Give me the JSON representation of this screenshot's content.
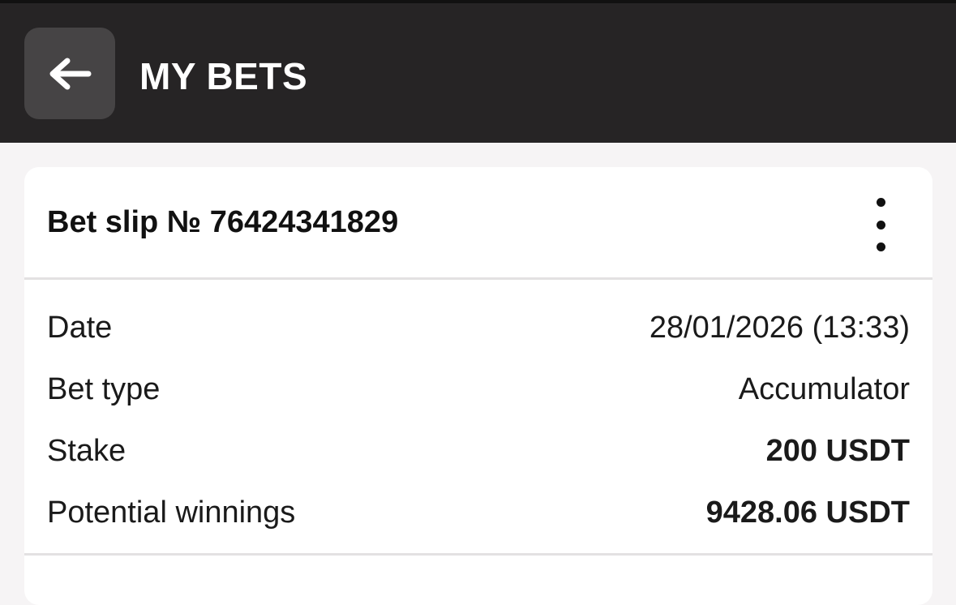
{
  "header": {
    "title": "MY BETS",
    "back_icon": "arrow-left-icon"
  },
  "bet_slip": {
    "title": "Bet slip № 76424341829",
    "menu_icon": "more-vertical-icon",
    "rows": [
      {
        "label": "Date",
        "value": "28/01/2026 (13:33)"
      },
      {
        "label": "Bet type",
        "value": "Accumulator"
      },
      {
        "label": "Stake",
        "value": "200 USDT"
      },
      {
        "label": "Potential winnings",
        "value": "9428.06 USDT"
      }
    ]
  },
  "colors": {
    "header_bg": "#262425",
    "back_button_bg": "#464445",
    "page_bg": "#f6f4f5",
    "card_bg": "#ffffff"
  }
}
